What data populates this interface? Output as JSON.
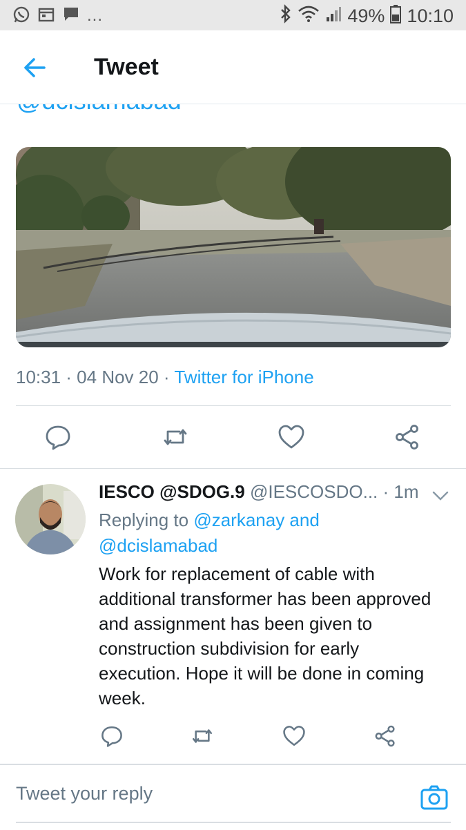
{
  "status_bar": {
    "battery": "49%",
    "time": "10:10",
    "notification_overflow": "..."
  },
  "header": {
    "title": "Tweet"
  },
  "original_tweet": {
    "mention_fragment": "@dcislamabad",
    "timestamp": "10:31 · 04 Nov 20 ·",
    "source": "Twitter for iPhone",
    "image_description": "road with fallen cable"
  },
  "reply": {
    "display_name": "IESCO @SDOG.9",
    "handle": "@IESCOSDO...",
    "time": "· 1m",
    "replying_prefix": "Replying to",
    "replying_user1": "@zarkanay and",
    "replying_user2": "@dcislamabad",
    "text": "Work for replacement of cable with additional transformer has been approved and assignment has been given to construction subdivision for early execution. Hope it will be done in coming week."
  },
  "compose": {
    "placeholder": "Tweet your reply"
  },
  "colors": {
    "accent": "#1da1f2",
    "muted": "#657786",
    "text": "#14171a"
  }
}
